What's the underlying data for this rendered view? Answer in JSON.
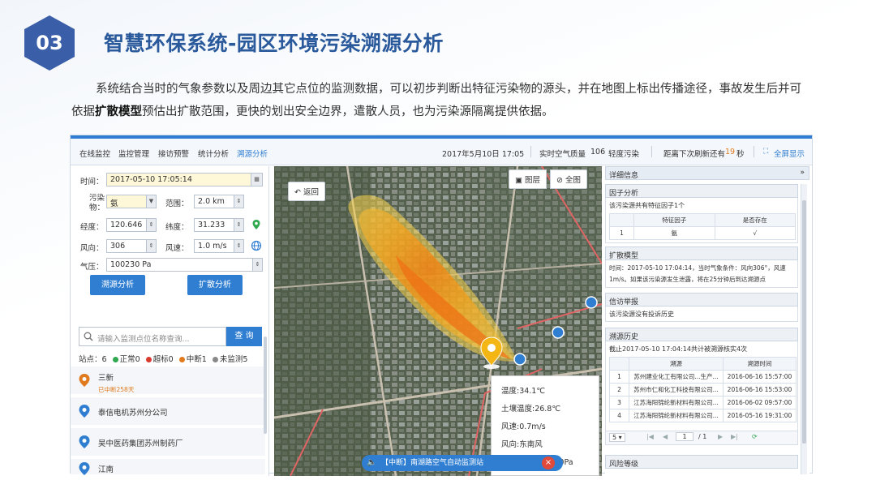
{
  "slide": {
    "badge": "03",
    "title": "智慧环保系统-园区环境污染溯源分析",
    "desc_part1": "系统结合当时的气象参数以及周边其它点位的监测数据，可以初步判断出特征污染物的源头，并在地图上标出传播途径，事故发生后并可依据",
    "desc_bold": "扩散模型",
    "desc_part2": "预估出扩散范围，更快的划出安全边界，遣散人员，也为污染源隔离提供依据。"
  },
  "topbar": {
    "nav": [
      "在线监控",
      "监控管理",
      "接访预警",
      "统计分析",
      "溯源分析"
    ],
    "active_nav": "溯源分析",
    "datetime": "2017年5月10日 17:05",
    "aqi_label": "实时空气质量",
    "aqi_value": "106",
    "aqi_level": "轻度污染",
    "refresh_prefix": "距离下次刷新还有",
    "refresh_seconds": "19",
    "refresh_suffix": "秒",
    "fullscreen": "全屏显示"
  },
  "form": {
    "time_label": "时间：",
    "time_value": "2017-05-10 17:05:14",
    "pollutant_label": "污染物：",
    "pollutant_value": "氨",
    "range_label": "范围：",
    "range_value": "2.0 km",
    "lng_label": "经度：",
    "lng_value": "120.646",
    "lat_label": "纬度：",
    "lat_value": "31.233",
    "winddir_label": "风向：",
    "winddir_value": "306",
    "windspeed_label": "风速：",
    "windspeed_value": "1.0 m/s",
    "pressure_label": "气压：",
    "pressure_value": "100230 Pa",
    "trace_btn": "溯源分析",
    "diffuse_btn": "扩散分析",
    "search_placeholder": "请输入监测点位名称查询...",
    "search_btn": "查 询"
  },
  "legend": {
    "prefix": "站点：6",
    "normal": "正常0",
    "over": "超标0",
    "interrupt": "中断1",
    "unmonitored": "未监测5",
    "colors": {
      "normal": "#2fa84f",
      "over": "#d83a2e",
      "interrupt": "#e07a1c",
      "unmonitored": "#888888"
    }
  },
  "stations": [
    {
      "name": "三新",
      "sub": "已中断258天"
    },
    {
      "name": "泰信电机苏州分公司",
      "sub": ""
    },
    {
      "name": "吴中医药集团苏州制药厂",
      "sub": ""
    },
    {
      "name": "江南",
      "sub": ""
    }
  ],
  "map": {
    "back_btn": "返回",
    "layer_btn": "图层",
    "full_btn": "全图",
    "popup": {
      "temp": "温度:34.1℃",
      "soil_temp": "土壤温度:26.8℃",
      "wind_speed": "风速:0.7m/s",
      "wind_dir": "风向:东南风",
      "pressure": "大气压力:100230Pa"
    },
    "alarm": "【中断】南湖路空气自动监测站"
  },
  "detail": {
    "header": "详细信息",
    "factor": {
      "title": "因子分析",
      "text": "该污染源共有特征因子1个",
      "col1": "特征因子",
      "col2": "是否存在",
      "rows": [
        {
          "no": "1",
          "factor": "氨",
          "exists": "√"
        }
      ]
    },
    "model": {
      "title": "扩散模型",
      "text1": "时间：2017-05-10 17:04:14，当时气象条件：风向306°，风速",
      "text2": "1m/s。如果该污染源发生泄露，将在25分钟后到达溯源点"
    },
    "complaint": {
      "title": "信访举报",
      "text": "该污染源没有投诉历史"
    },
    "history": {
      "title": "溯源历史",
      "text": "截止2017-05-10 17:04:14共计被溯源核实4次",
      "col1": "溯源",
      "col2": "溯源时间",
      "rows": [
        {
          "no": "1",
          "name": "苏州建业化工有限公司...生产...",
          "time": "2016-06-16 15:57:00"
        },
        {
          "no": "2",
          "name": "苏州市仁和化工科技有限公司...",
          "time": "2016-06-16 15:53:00"
        },
        {
          "no": "3",
          "name": "江苏海阳锦纶新材料有限公司...",
          "time": "2016-06-02 09:57:00"
        },
        {
          "no": "4",
          "name": "江苏海阳锦纶新材料有限公司...",
          "time": "2016-05-16 19:31:00"
        }
      ],
      "page_size": "5",
      "page_current": "1",
      "page_total": "/ 1"
    },
    "risk": {
      "title": "风险等级"
    }
  }
}
